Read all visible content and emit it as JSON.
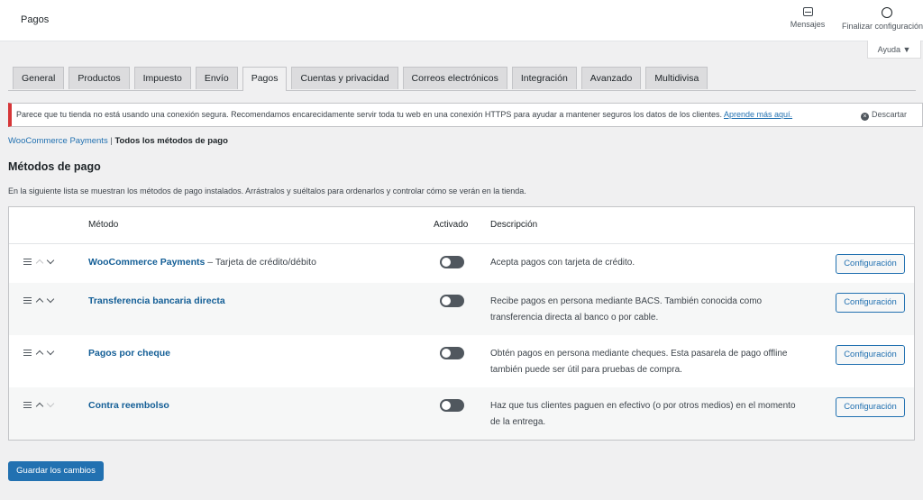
{
  "header": {
    "page_title": "Pagos",
    "messages_label": "Mensajes",
    "finish_setup_label": "Finalizar configuración",
    "help_label": "Ayuda ▼"
  },
  "tabs": [
    {
      "label": "General",
      "active": false
    },
    {
      "label": "Productos",
      "active": false
    },
    {
      "label": "Impuesto",
      "active": false
    },
    {
      "label": "Envío",
      "active": false
    },
    {
      "label": "Pagos",
      "active": true
    },
    {
      "label": "Cuentas y privacidad",
      "active": false
    },
    {
      "label": "Correos electrónicos",
      "active": false
    },
    {
      "label": "Integración",
      "active": false
    },
    {
      "label": "Avanzado",
      "active": false
    },
    {
      "label": "Multidivisa",
      "active": false
    }
  ],
  "notice": {
    "text": "Parece que tu tienda no está usando una conexión segura. Recomendamos encarecidamente servir toda tu web en una conexión HTTPS para ayudar a mantener seguros los datos de los clientes.",
    "link": "Aprende más aquí.",
    "dismiss": "Descartar"
  },
  "subsub": {
    "link": "WooCommerce Payments",
    "separator": "|",
    "current": "Todos los métodos de pago"
  },
  "section": {
    "title": "Métodos de pago",
    "description": "En la siguiente lista se muestran los métodos de pago instalados. Arrástralos y suéltalos para ordenarlos y controlar cómo se verán en la tienda."
  },
  "table": {
    "headers": {
      "method": "Método",
      "enabled": "Activado",
      "description": "Descripción"
    },
    "rows": [
      {
        "name": "WooCommerce Payments",
        "suffix": " – Tarjeta de crédito/débito",
        "enabled": false,
        "description": "Acepta pagos con tarjeta de crédito.",
        "button": "Configuración"
      },
      {
        "name": "Transferencia bancaria directa",
        "suffix": "",
        "enabled": false,
        "description": "Recibe pagos en persona mediante BACS. También conocida como transferencia directa al banco o por cable.",
        "button": "Configuración"
      },
      {
        "name": "Pagos por cheque",
        "suffix": "",
        "enabled": false,
        "description": "Obtén pagos en persona mediante cheques. Esta pasarela de pago offline también puede ser útil para pruebas de compra.",
        "button": "Configuración"
      },
      {
        "name": "Contra reembolso",
        "suffix": "",
        "enabled": false,
        "description": "Haz que tus clientes paguen en efectivo (o por otros medios) en el momento de la entrega.",
        "button": "Configuración"
      }
    ]
  },
  "save_button": "Guardar los cambios",
  "colors": {
    "accent": "#2271b1",
    "notice_error": "#d63638"
  }
}
